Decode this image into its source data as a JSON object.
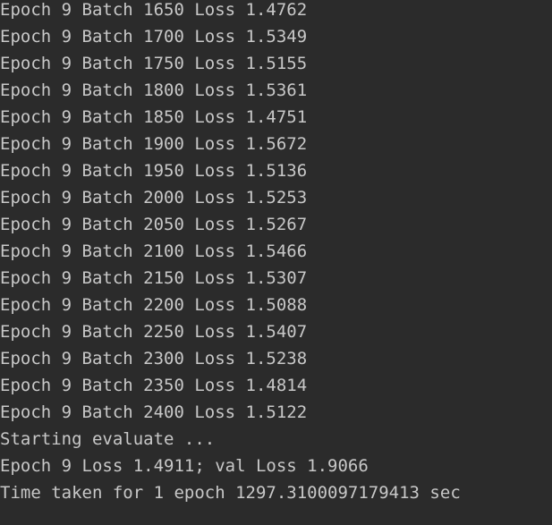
{
  "console": {
    "lines": [
      "Epoch 9 Batch 1650 Loss 1.4762",
      "Epoch 9 Batch 1700 Loss 1.5349",
      "Epoch 9 Batch 1750 Loss 1.5155",
      "Epoch 9 Batch 1800 Loss 1.5361",
      "Epoch 9 Batch 1850 Loss 1.4751",
      "Epoch 9 Batch 1900 Loss 1.5672",
      "Epoch 9 Batch 1950 Loss 1.5136",
      "Epoch 9 Batch 2000 Loss 1.5253",
      "Epoch 9 Batch 2050 Loss 1.5267",
      "Epoch 9 Batch 2100 Loss 1.5466",
      "Epoch 9 Batch 2150 Loss 1.5307",
      "Epoch 9 Batch 2200 Loss 1.5088",
      "Epoch 9 Batch 2250 Loss 1.5407",
      "Epoch 9 Batch 2300 Loss 1.5238",
      "Epoch 9 Batch 2350 Loss 1.4814",
      "Epoch 9 Batch 2400 Loss 1.5122",
      "Starting evaluate ...",
      "Epoch 9 Loss 1.4911; val Loss 1.9066",
      "Time taken for 1 epoch 1297.3100097179413 sec"
    ]
  },
  "colors": {
    "background": "#2b2b2b",
    "text": "#c8c8c8"
  }
}
